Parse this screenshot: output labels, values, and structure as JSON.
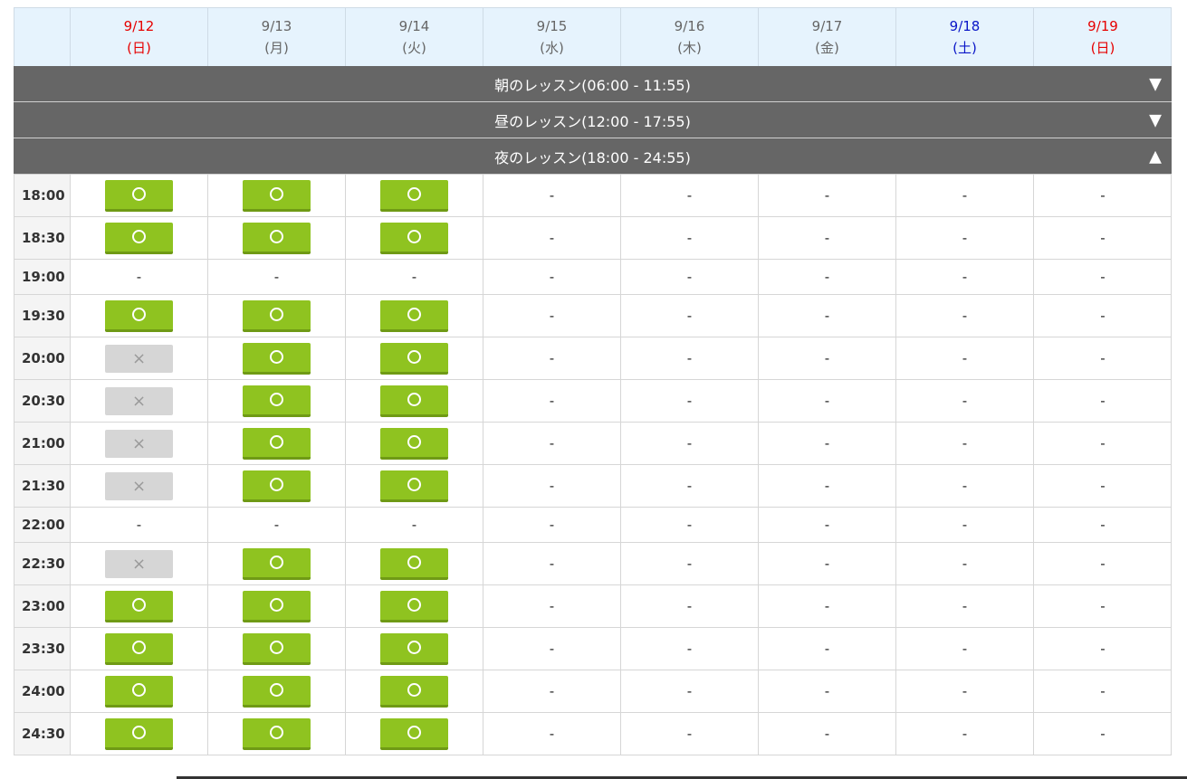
{
  "days": [
    {
      "date": "9/12",
      "dow": "(日)",
      "kind": "sun"
    },
    {
      "date": "9/13",
      "dow": "(月)",
      "kind": "wk"
    },
    {
      "date": "9/14",
      "dow": "(火)",
      "kind": "wk"
    },
    {
      "date": "9/15",
      "dow": "(水)",
      "kind": "wk"
    },
    {
      "date": "9/16",
      "dow": "(木)",
      "kind": "wk"
    },
    {
      "date": "9/17",
      "dow": "(金)",
      "kind": "wk"
    },
    {
      "date": "9/18",
      "dow": "(土)",
      "kind": "sat"
    },
    {
      "date": "9/19",
      "dow": "(日)",
      "kind": "sun"
    }
  ],
  "bands": [
    {
      "label": "朝のレッスン(06:00 - 11:55)",
      "arrow": "▼"
    },
    {
      "label": "昼のレッスン(12:00 - 17:55)",
      "arrow": "▼"
    },
    {
      "label": "夜のレッスン(18:00 - 24:55)",
      "arrow": "▲"
    }
  ],
  "slots": [
    {
      "time": "18:00",
      "cells": [
        "o",
        "o",
        "o",
        "-",
        "-",
        "-",
        "-",
        "-"
      ]
    },
    {
      "time": "18:30",
      "cells": [
        "o",
        "o",
        "o",
        "-",
        "-",
        "-",
        "-",
        "-"
      ]
    },
    {
      "time": "19:00",
      "cells": [
        "-",
        "-",
        "-",
        "-",
        "-",
        "-",
        "-",
        "-"
      ]
    },
    {
      "time": "19:30",
      "cells": [
        "o",
        "o",
        "o",
        "-",
        "-",
        "-",
        "-",
        "-"
      ]
    },
    {
      "time": "20:00",
      "cells": [
        "x",
        "o",
        "o",
        "-",
        "-",
        "-",
        "-",
        "-"
      ]
    },
    {
      "time": "20:30",
      "cells": [
        "x",
        "o",
        "o",
        "-",
        "-",
        "-",
        "-",
        "-"
      ]
    },
    {
      "time": "21:00",
      "cells": [
        "x",
        "o",
        "o",
        "-",
        "-",
        "-",
        "-",
        "-"
      ]
    },
    {
      "time": "21:30",
      "cells": [
        "x",
        "o",
        "o",
        "-",
        "-",
        "-",
        "-",
        "-"
      ]
    },
    {
      "time": "22:00",
      "cells": [
        "-",
        "-",
        "-",
        "-",
        "-",
        "-",
        "-",
        "-"
      ]
    },
    {
      "time": "22:30",
      "cells": [
        "x",
        "o",
        "o",
        "-",
        "-",
        "-",
        "-",
        "-"
      ]
    },
    {
      "time": "23:00",
      "cells": [
        "o",
        "o",
        "o",
        "-",
        "-",
        "-",
        "-",
        "-"
      ]
    },
    {
      "time": "23:30",
      "cells": [
        "o",
        "o",
        "o",
        "-",
        "-",
        "-",
        "-",
        "-"
      ]
    },
    {
      "time": "24:00",
      "cells": [
        "o",
        "o",
        "o",
        "-",
        "-",
        "-",
        "-",
        "-"
      ]
    },
    {
      "time": "24:30",
      "cells": [
        "o",
        "o",
        "o",
        "-",
        "-",
        "-",
        "-",
        "-"
      ]
    }
  ],
  "symbols": {
    "unavailable": "×",
    "none": "-"
  },
  "icons": {
    "available": "circle-icon",
    "unavailable": "cross-icon",
    "collapse": "triangle-up-icon",
    "expand": "triangle-down-icon"
  },
  "colors": {
    "sunday": "#e60000",
    "saturday": "#0a16c8",
    "available": "#8fc320",
    "unavailable": "#d6d6d6",
    "band": "#666666",
    "header": "#e6f3fd"
  }
}
